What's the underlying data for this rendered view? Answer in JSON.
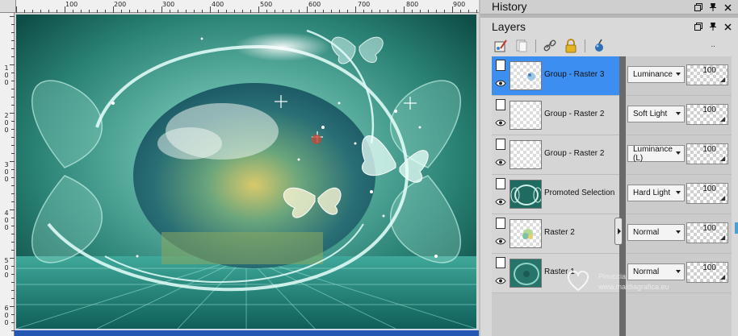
{
  "ruler": {
    "h_labels": [
      "100",
      "200",
      "300",
      "400",
      "500",
      "600",
      "700",
      "800",
      "900"
    ],
    "v_labels": [
      [
        "1",
        "0",
        "0"
      ],
      [
        "2",
        "0",
        "0"
      ],
      [
        "3",
        "0",
        "0"
      ],
      [
        "4",
        "0",
        "0"
      ],
      [
        "5",
        "0",
        "0"
      ],
      [
        "6",
        "0",
        "0"
      ]
    ]
  },
  "history": {
    "title": "History"
  },
  "layers": {
    "title": "Layers",
    "toolbar_dots": "..",
    "rows": [
      {
        "name": "Group - Raster 3",
        "blend": "Luminance",
        "opacity": "100",
        "active": true
      },
      {
        "name": "Group - Raster 2",
        "blend": "Soft Light",
        "opacity": "100",
        "active": false
      },
      {
        "name": "Group - Raster 2",
        "blend": "Luminance (L)",
        "opacity": "100",
        "active": false
      },
      {
        "name": "Promoted Selection",
        "blend": "Hard Light",
        "opacity": "100",
        "active": false
      },
      {
        "name": "Raster 2",
        "blend": "Normal",
        "opacity": "100",
        "active": false
      },
      {
        "name": "Raster 1",
        "blend": "Normal",
        "opacity": "100",
        "active": false
      }
    ]
  },
  "watermark": {
    "name": "Pinuccia",
    "site": "www.maldiagrafica.eu"
  },
  "colors": {
    "active_layer": "#3c8ff0",
    "canvas_teal": "#1d6f66",
    "bottom_strip": "#2457b3"
  }
}
